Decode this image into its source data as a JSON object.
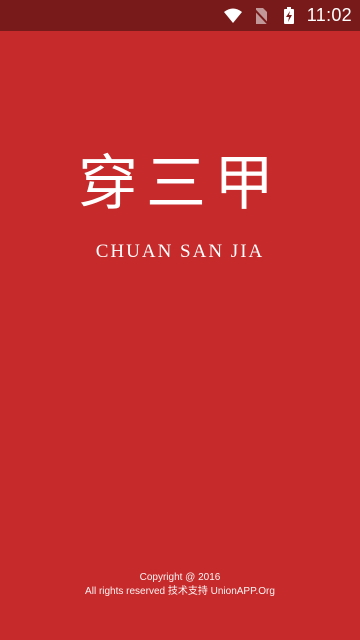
{
  "status_bar": {
    "time": "11:02",
    "icons": [
      "wifi-icon",
      "no-sim-icon",
      "battery-charging-icon"
    ]
  },
  "splash": {
    "title": "穿三甲",
    "subtitle": "CHUAN SAN JIA",
    "footer": {
      "copyright": "Copyright @ 2016",
      "rights": "All rights reserved 技术支持 UnionAPP.Org"
    }
  },
  "colors": {
    "background": "#c62a2b",
    "status_bar": "#781a1a",
    "text": "#ffffff"
  }
}
